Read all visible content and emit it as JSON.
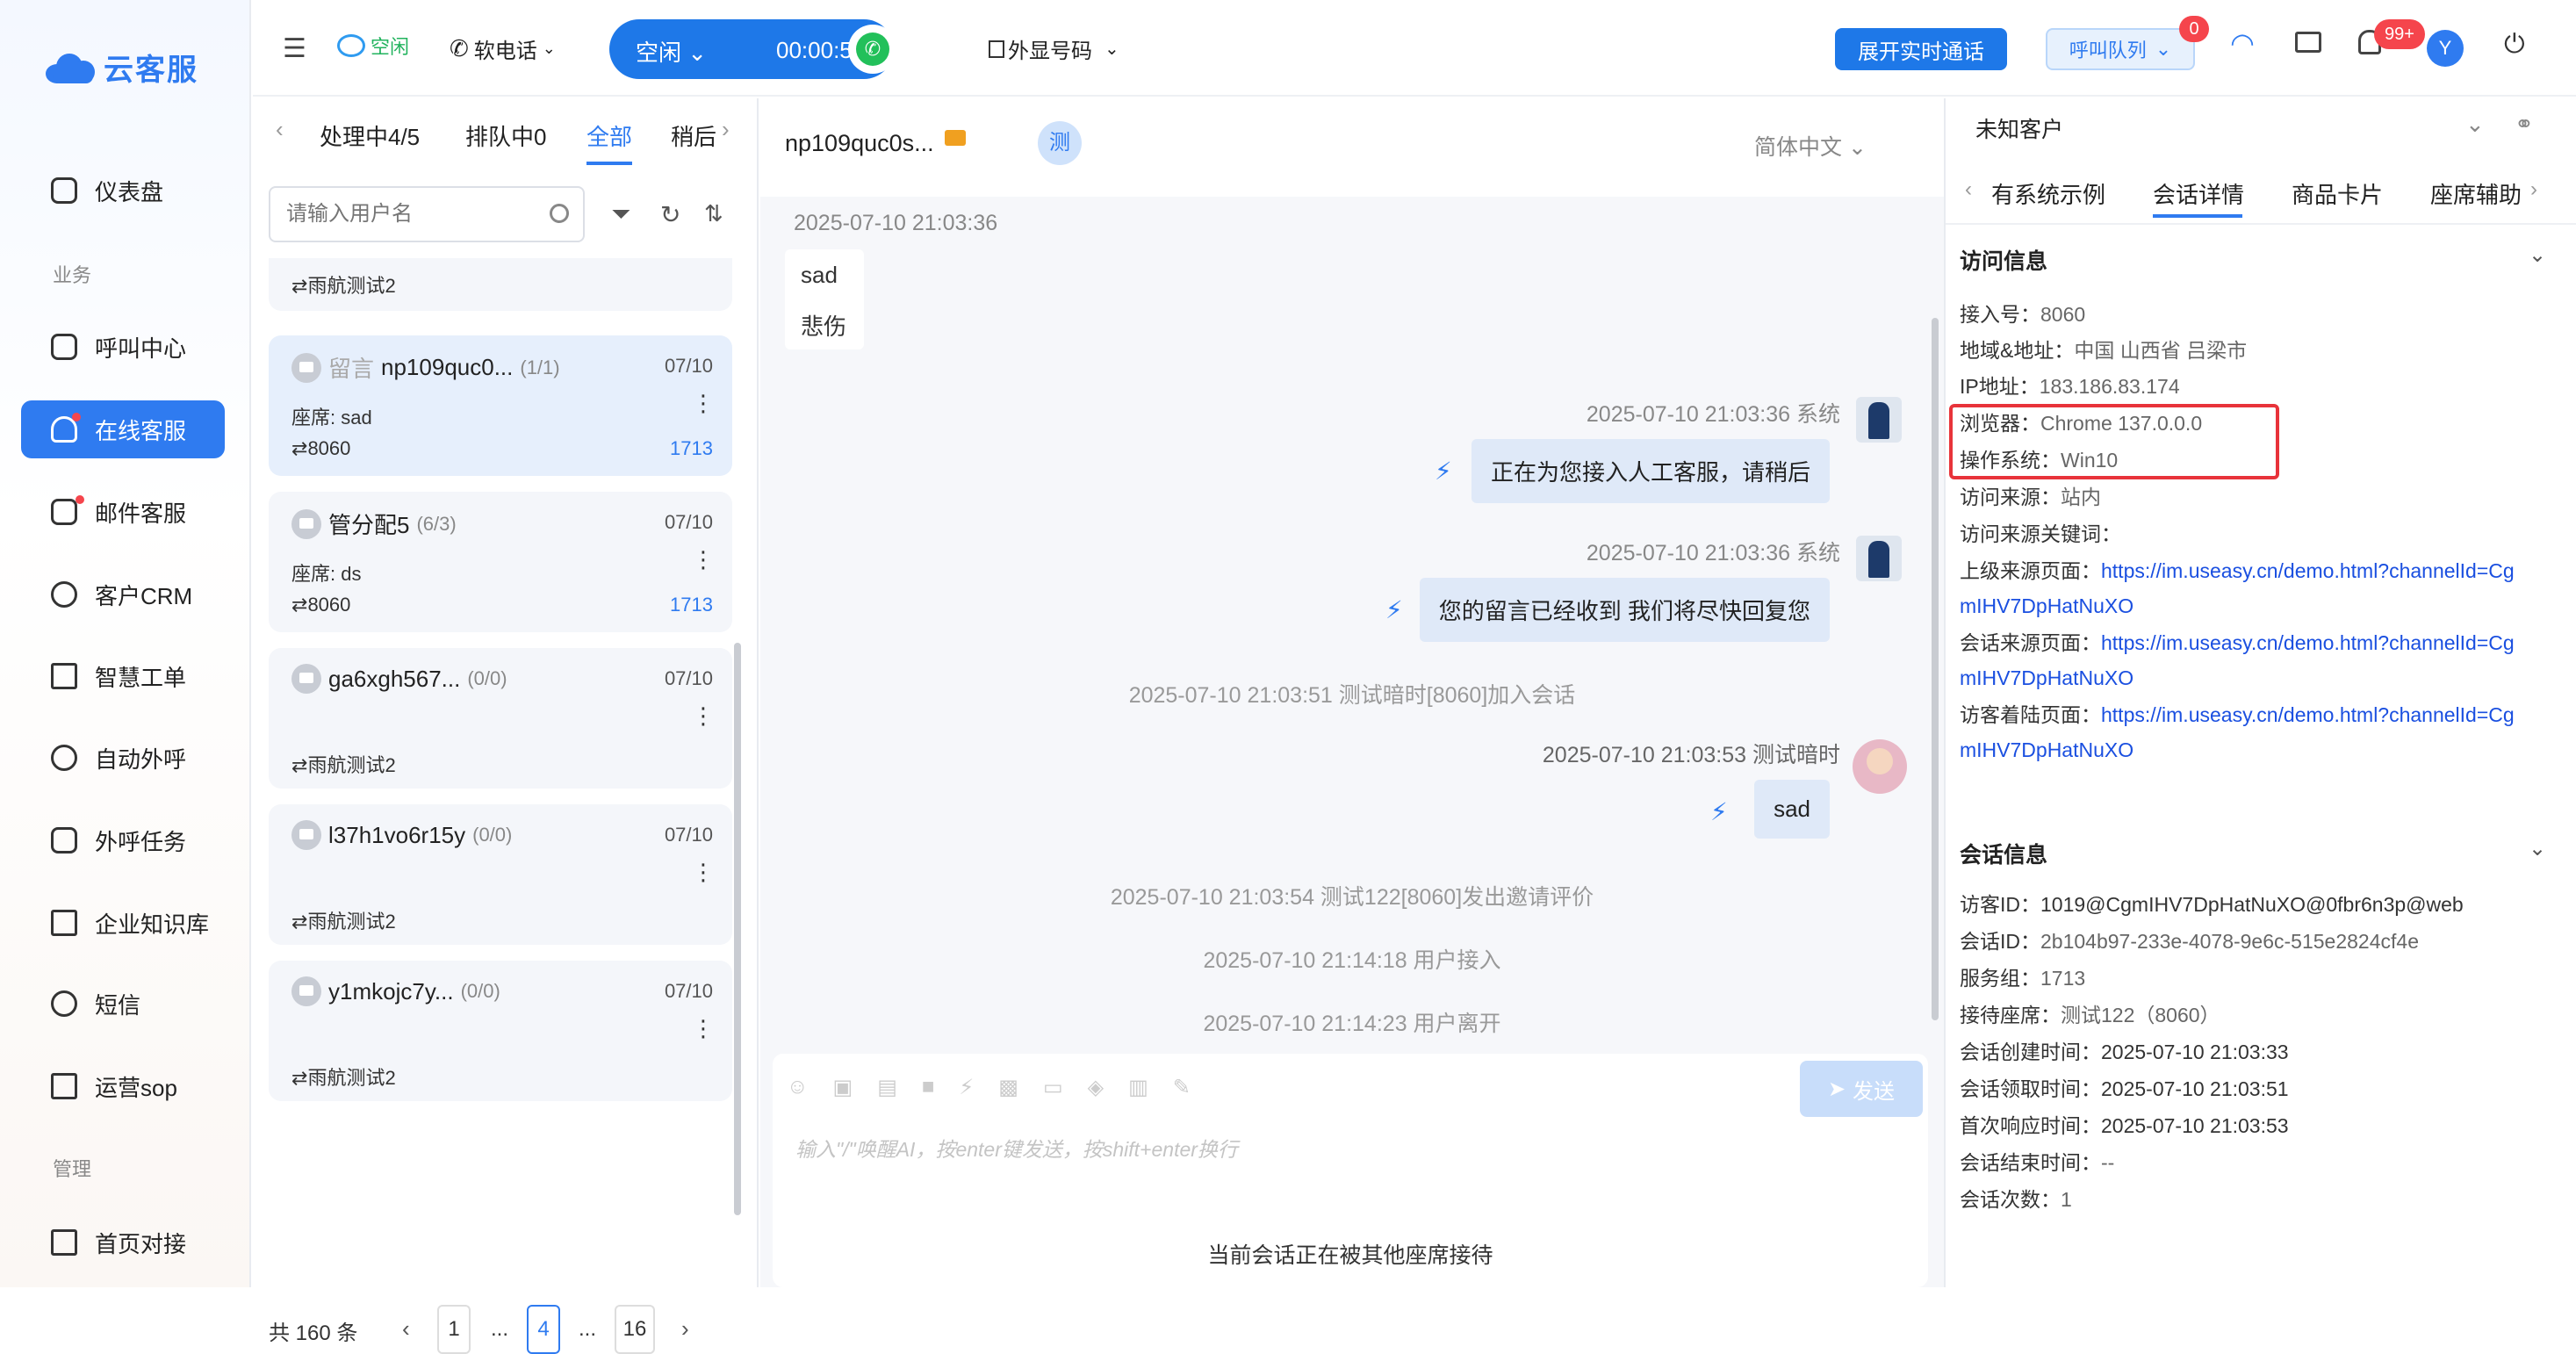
{
  "app": {
    "name": "云客服"
  },
  "sidebar": {
    "section_business": "业务",
    "section_manage": "管理",
    "items": [
      {
        "label": "仪表盘",
        "icon": "home-icon"
      },
      {
        "label": "呼叫中心",
        "icon": "phone-icon"
      },
      {
        "label": "在线客服",
        "icon": "headset-icon"
      },
      {
        "label": "邮件客服",
        "icon": "mail-icon"
      },
      {
        "label": "客户CRM",
        "icon": "user-icon"
      },
      {
        "label": "智慧工单",
        "icon": "document-icon"
      },
      {
        "label": "自动外呼",
        "icon": "whatsapp-icon"
      },
      {
        "label": "外呼任务",
        "icon": "phone-out-icon"
      },
      {
        "label": "企业知识库",
        "icon": "book-icon"
      },
      {
        "label": "短信",
        "icon": "sms-icon"
      },
      {
        "label": "运营sop",
        "icon": "flow-icon"
      },
      {
        "label": "首页对接",
        "icon": "chart-icon"
      }
    ]
  },
  "topbar": {
    "status": "空闲",
    "softphone": "软电话",
    "call_state": "空闲",
    "call_timer": "00:00:58",
    "outbound_number": "外显号码",
    "realtime_btn": "展开实时通话",
    "queue_btn": "呼叫队列",
    "queue_badge": "0",
    "notify_badge": "99+",
    "avatar_letter": "Y"
  },
  "list": {
    "tabs": [
      "处理中4/5",
      "排队中0",
      "全部",
      "稍后"
    ],
    "active_tab": "全部",
    "search_placeholder": "请输入用户名",
    "partial_group": "雨航测试2",
    "items": [
      {
        "prefix": "留言",
        "name": "np109quc0...",
        "count": "(1/1)",
        "date": "07/10",
        "agent": "座席: sad",
        "channel": "8060",
        "group": "1713"
      },
      {
        "prefix": "",
        "name": "管分配5",
        "count": "(6/3)",
        "date": "07/10",
        "agent": "座席: ds",
        "channel": "8060",
        "group": "1713"
      },
      {
        "prefix": "",
        "name": "ga6xgh567...",
        "count": "(0/0)",
        "date": "07/10",
        "agent": "",
        "channel": "雨航测试2",
        "group": ""
      },
      {
        "prefix": "",
        "name": "l37h1vo6r15y",
        "count": "(0/0)",
        "date": "07/10",
        "agent": "",
        "channel": "雨航测试2",
        "group": ""
      },
      {
        "prefix": "",
        "name": "y1mkojc7y...",
        "count": "(0/0)",
        "date": "07/10",
        "agent": "",
        "channel": "雨航测试2",
        "group": ""
      }
    ],
    "total": "共 160 条",
    "pages": [
      "1",
      "...",
      "4",
      "...",
      "16"
    ],
    "current_page": "4"
  },
  "chat": {
    "title": "np109quc0s...",
    "tag": "测",
    "lang": "简体中文",
    "first_time": "2025-07-10 21:03:36",
    "customer_msgs": [
      "sad",
      "悲伤"
    ],
    "sys1_time": "2025-07-10 21:03:36 系统",
    "sys1_msg": "正在为您接入人工客服，请稍后",
    "sys2_time": "2025-07-10 21:03:36 系统",
    "sys2_msg": "您的留言已经收到 我们将尽快回复您",
    "join_line": "2025-07-10 21:03:51 测试暗时[8060]加入会话",
    "agent_time": "2025-07-10 21:03:53 测试暗时",
    "agent_msg": "sad",
    "invite_line": "2025-07-10 21:03:54 测试122[8060]发出邀请评价",
    "access_line": "2025-07-10 21:14:18 用户接入",
    "leave_line": "2025-07-10 21:14:23 用户离开",
    "send_btn": "发送",
    "input_placeholder": "输入\"/\"唤醒AI，按enter键发送，按shift+enter换行",
    "footer_note": "当前会话正在被其他座席接待"
  },
  "right": {
    "customer": "未知客户",
    "tabs": [
      "有系统示例",
      "会话详情",
      "商品卡片",
      "座席辅助"
    ],
    "active_tab": "会话详情",
    "visit_title": "访问信息",
    "visit": [
      {
        "k": "接入号：",
        "v": "8060"
      },
      {
        "k": "地域&地址：",
        "v": "中国 山西省 吕梁市"
      },
      {
        "k": "IP地址：",
        "v": "183.186.83.174"
      },
      {
        "k": "浏览器：",
        "v": "Chrome 137.0.0.0"
      },
      {
        "k": "操作系统：",
        "v": "Win10"
      },
      {
        "k": "访问来源：",
        "v": "站内"
      },
      {
        "k": "访问来源关键词：",
        "v": ""
      }
    ],
    "links": [
      {
        "k": "上级来源页面：",
        "l1": "https://im.useasy.cn/demo.html?channelId=Cg",
        "l2": "mIHV7DpHatNuXO"
      },
      {
        "k": "会话来源页面：",
        "l1": "https://im.useasy.cn/demo.html?channelId=Cg",
        "l2": "mIHV7DpHatNuXO"
      },
      {
        "k": "访客着陆页面：",
        "l1": "https://im.useasy.cn/demo.html?channelId=Cg",
        "l2": "mIHV7DpHatNuXO"
      }
    ],
    "session_title": "会话信息",
    "session": [
      {
        "k": "访客ID：",
        "v": "1019@CgmIHV7DpHatNuXO@0fbr6n3p@web"
      },
      {
        "k": "会话ID：",
        "v": "2b104b97-233e-4078-9e6c-515e2824cf4e"
      },
      {
        "k": "服务组：",
        "v": "1713"
      },
      {
        "k": "接待座席：",
        "v": "测试122（8060）"
      },
      {
        "k": "会话创建时间：",
        "v": "2025-07-10 21:03:33"
      },
      {
        "k": "会话领取时间：",
        "v": "2025-07-10 21:03:51"
      },
      {
        "k": "首次响应时间：",
        "v": "2025-07-10 21:03:53"
      },
      {
        "k": "会话结束时间：",
        "v": "--"
      },
      {
        "k": "会话次数：",
        "v": "1"
      }
    ]
  },
  "colors": {
    "primary": "#2f7bf0",
    "highlight": "#e8333a",
    "badge": "#f5454c"
  }
}
